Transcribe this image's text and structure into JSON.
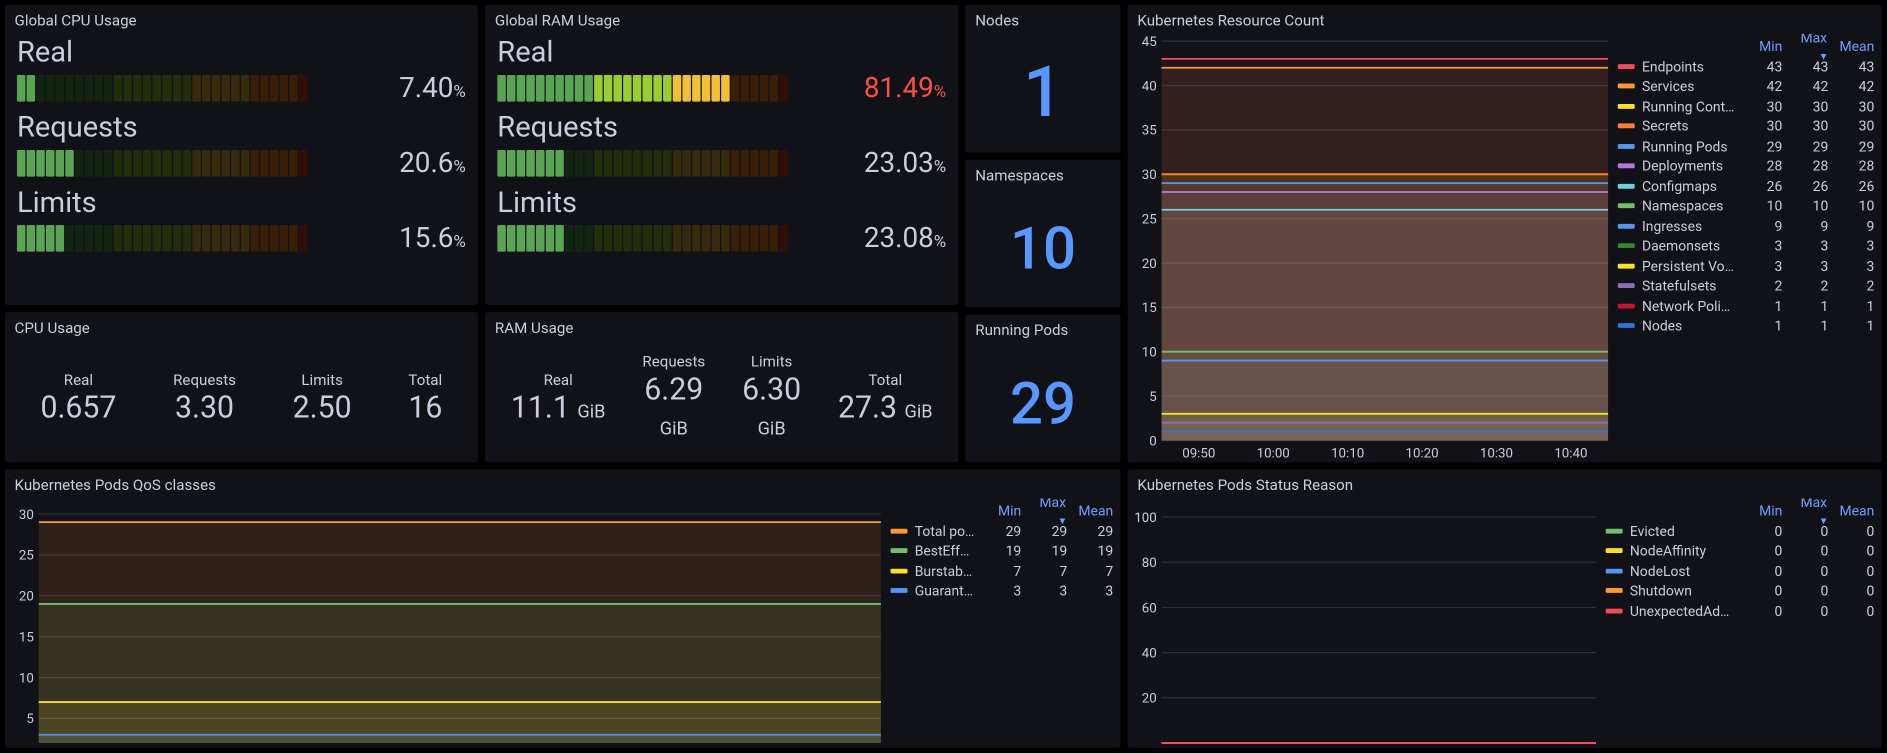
{
  "panels": {
    "cpu": {
      "title": "Global CPU Usage",
      "gauges": [
        {
          "label": "Real",
          "value": 7.4,
          "display": "7.40"
        },
        {
          "label": "Requests",
          "value": 20.6,
          "display": "20.6"
        },
        {
          "label": "Limits",
          "value": 15.6,
          "display": "15.6"
        }
      ]
    },
    "ram": {
      "title": "Global RAM Usage",
      "gauges": [
        {
          "label": "Real",
          "value": 81.49,
          "display": "81.49",
          "valcolor": "#ff4e42"
        },
        {
          "label": "Requests",
          "value": 23.03,
          "display": "23.03"
        },
        {
          "label": "Limits",
          "value": 23.08,
          "display": "23.08"
        }
      ]
    },
    "cpuUsage": {
      "title": "CPU Usage",
      "stats": [
        {
          "label": "Real",
          "value": "0.657",
          "unit": ""
        },
        {
          "label": "Requests",
          "value": "3.30",
          "unit": ""
        },
        {
          "label": "Limits",
          "value": "2.50",
          "unit": ""
        },
        {
          "label": "Total",
          "value": "16",
          "unit": ""
        }
      ]
    },
    "ramUsage": {
      "title": "RAM Usage",
      "stats": [
        {
          "label": "Real",
          "value": "11.1",
          "unit": "GiB",
          "inline": true
        },
        {
          "label": "Requests",
          "value": "6.29",
          "unit": "GiB"
        },
        {
          "label": "Limits",
          "value": "6.30",
          "unit": "GiB"
        },
        {
          "label": "Total",
          "value": "27.3",
          "unit": "GiB",
          "inline": true
        }
      ]
    },
    "nodes": {
      "title": "Nodes",
      "value": "1"
    },
    "namespaces": {
      "title": "Namespaces",
      "value": "10"
    },
    "runpods": {
      "title": "Running Pods",
      "value": "29"
    },
    "resourceCount": {
      "title": "Kubernetes Resource Count",
      "legendHeaders": [
        "Min",
        "Max",
        "Mean"
      ],
      "sortCol": 1,
      "yTicks": [
        0,
        5,
        10,
        15,
        20,
        25,
        30,
        35,
        40,
        45
      ],
      "xTicks": [
        "09:50",
        "10:00",
        "10:10",
        "10:20",
        "10:30",
        "10:40"
      ],
      "series": [
        {
          "name": "Endpoints",
          "color": "#f2495c",
          "vals": [
            43,
            43,
            43
          ]
        },
        {
          "name": "Services",
          "color": "#ff9830",
          "vals": [
            42,
            42,
            42
          ]
        },
        {
          "name": "Running Containers",
          "color": "#fade2a",
          "vals": [
            30,
            30,
            30
          ]
        },
        {
          "name": "Secrets",
          "color": "#ff7d30",
          "vals": [
            30,
            30,
            30
          ]
        },
        {
          "name": "Running Pods",
          "color": "#5794f2",
          "vals": [
            29,
            29,
            29
          ]
        },
        {
          "name": "Deployments",
          "color": "#b877d9",
          "vals": [
            28,
            28,
            28
          ]
        },
        {
          "name": "Configmaps",
          "color": "#6ed0e0",
          "vals": [
            26,
            26,
            26
          ]
        },
        {
          "name": "Namespaces",
          "color": "#73bf69",
          "vals": [
            10,
            10,
            10
          ]
        },
        {
          "name": "Ingresses",
          "color": "#5794f2",
          "vals": [
            9,
            9,
            9
          ]
        },
        {
          "name": "Daemonsets",
          "color": "#37872d",
          "vals": [
            3,
            3,
            3
          ]
        },
        {
          "name": "Persistent Volume Claims",
          "color": "#fade2a",
          "vals": [
            3,
            3,
            3
          ]
        },
        {
          "name": "Statefulsets",
          "color": "#8e6eb8",
          "vals": [
            2,
            2,
            2
          ]
        },
        {
          "name": "Network Policies",
          "color": "#c4162a",
          "vals": [
            1,
            1,
            1
          ]
        },
        {
          "name": "Nodes",
          "color": "#3274d9",
          "vals": [
            1,
            1,
            1
          ]
        }
      ]
    },
    "qos": {
      "title": "Kubernetes Pods QoS classes",
      "legendHeaders": [
        "Min",
        "Max",
        "Mean"
      ],
      "sortCol": 1,
      "yTicks": [
        5,
        10,
        15,
        20,
        25,
        30
      ],
      "series": [
        {
          "name": "Total pods",
          "color": "#ff9830",
          "vals": [
            29,
            29,
            29
          ]
        },
        {
          "name": "BestEffort pods",
          "color": "#73bf69",
          "vals": [
            19,
            19,
            19
          ]
        },
        {
          "name": "Burstable pods",
          "color": "#fade2a",
          "vals": [
            7,
            7,
            7
          ]
        },
        {
          "name": "Guaranteed pods",
          "color": "#5794f2",
          "vals": [
            3,
            3,
            3
          ]
        }
      ]
    },
    "statusReason": {
      "title": "Kubernetes Pods Status Reason",
      "legendHeaders": [
        "Min",
        "Max",
        "Mean"
      ],
      "sortCol": 1,
      "yTicks": [
        20,
        40,
        60,
        80,
        100
      ],
      "series": [
        {
          "name": "Evicted",
          "color": "#73bf69",
          "vals": [
            0,
            0,
            0
          ]
        },
        {
          "name": "NodeAffinity",
          "color": "#fade2a",
          "vals": [
            0,
            0,
            0
          ]
        },
        {
          "name": "NodeLost",
          "color": "#5794f2",
          "vals": [
            0,
            0,
            0
          ]
        },
        {
          "name": "Shutdown",
          "color": "#ff9830",
          "vals": [
            0,
            0,
            0
          ]
        },
        {
          "name": "UnexpectedAdmissionError",
          "color": "#f2495c",
          "vals": [
            0,
            0,
            0
          ]
        }
      ]
    }
  },
  "chart_data": [
    {
      "type": "bar",
      "title": "Global CPU Usage",
      "categories": [
        "Real",
        "Requests",
        "Limits"
      ],
      "values": [
        7.4,
        20.6,
        15.6
      ],
      "ylabel": "%",
      "ylim": [
        0,
        100
      ]
    },
    {
      "type": "bar",
      "title": "Global RAM Usage",
      "categories": [
        "Real",
        "Requests",
        "Limits"
      ],
      "values": [
        81.49,
        23.03,
        23.08
      ],
      "ylabel": "%",
      "ylim": [
        0,
        100
      ]
    },
    {
      "type": "table",
      "title": "CPU Usage",
      "categories": [
        "Real",
        "Requests",
        "Limits",
        "Total"
      ],
      "values": [
        0.657,
        3.3,
        2.5,
        16
      ]
    },
    {
      "type": "table",
      "title": "RAM Usage (GiB)",
      "categories": [
        "Real",
        "Requests",
        "Limits",
        "Total"
      ],
      "values": [
        11.1,
        6.29,
        6.3,
        27.3
      ]
    },
    {
      "type": "line",
      "title": "Kubernetes Resource Count",
      "x": [
        "09:50",
        "10:00",
        "10:10",
        "10:20",
        "10:30",
        "10:40"
      ],
      "ylim": [
        0,
        45
      ],
      "series": [
        {
          "name": "Endpoints",
          "values": [
            43,
            43,
            43,
            43,
            43,
            43
          ]
        },
        {
          "name": "Services",
          "values": [
            42,
            42,
            42,
            42,
            42,
            42
          ]
        },
        {
          "name": "Running Containers",
          "values": [
            30,
            30,
            30,
            30,
            30,
            30
          ]
        },
        {
          "name": "Secrets",
          "values": [
            30,
            30,
            30,
            30,
            30,
            30
          ]
        },
        {
          "name": "Running Pods",
          "values": [
            29,
            29,
            29,
            29,
            29,
            29
          ]
        },
        {
          "name": "Deployments",
          "values": [
            28,
            28,
            28,
            28,
            28,
            28
          ]
        },
        {
          "name": "Configmaps",
          "values": [
            26,
            26,
            26,
            26,
            26,
            26
          ]
        },
        {
          "name": "Namespaces",
          "values": [
            10,
            10,
            10,
            10,
            10,
            10
          ]
        },
        {
          "name": "Ingresses",
          "values": [
            9,
            9,
            9,
            9,
            9,
            9
          ]
        },
        {
          "name": "Daemonsets",
          "values": [
            3,
            3,
            3,
            3,
            3,
            3
          ]
        },
        {
          "name": "Persistent Volume Claims",
          "values": [
            3,
            3,
            3,
            3,
            3,
            3
          ]
        },
        {
          "name": "Statefulsets",
          "values": [
            2,
            2,
            2,
            2,
            2,
            2
          ]
        },
        {
          "name": "Network Policies",
          "values": [
            1,
            1,
            1,
            1,
            1,
            1
          ]
        },
        {
          "name": "Nodes",
          "values": [
            1,
            1,
            1,
            1,
            1,
            1
          ]
        }
      ]
    },
    {
      "type": "area",
      "title": "Kubernetes Pods QoS classes",
      "ylim": [
        3,
        30
      ],
      "series": [
        {
          "name": "Total pods",
          "values": [
            29
          ]
        },
        {
          "name": "BestEffort pods",
          "values": [
            19
          ]
        },
        {
          "name": "Burstable pods",
          "values": [
            7
          ]
        },
        {
          "name": "Guaranteed pods",
          "values": [
            3
          ]
        }
      ]
    },
    {
      "type": "line",
      "title": "Kubernetes Pods Status Reason",
      "ylim": [
        0,
        100
      ],
      "series": [
        {
          "name": "Evicted",
          "values": [
            0
          ]
        },
        {
          "name": "NodeAffinity",
          "values": [
            0
          ]
        },
        {
          "name": "NodeLost",
          "values": [
            0
          ]
        },
        {
          "name": "Shutdown",
          "values": [
            0
          ]
        },
        {
          "name": "UnexpectedAdmissionError",
          "values": [
            0
          ]
        }
      ]
    }
  ]
}
